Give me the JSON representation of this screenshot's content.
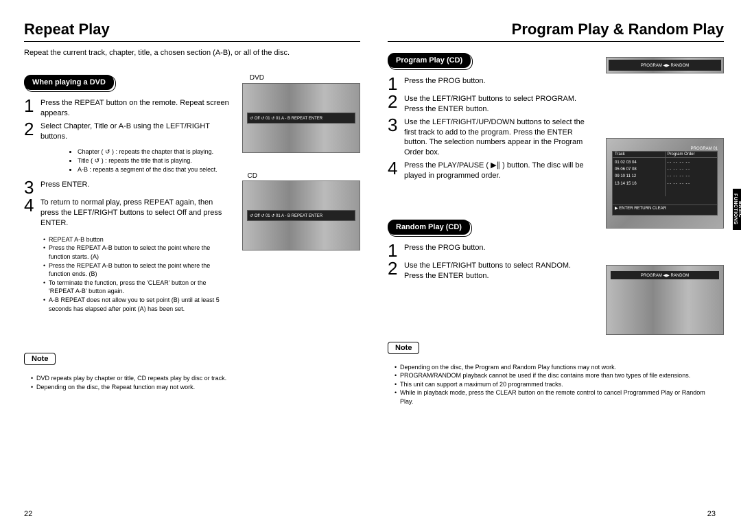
{
  "left": {
    "title": "Repeat Play",
    "intro": "Repeat the current track, chapter, title, a chosen section (A-B), or all of the disc.",
    "section1_label": "When playing a DVD",
    "dvd_label": "DVD",
    "cd_label": "CD",
    "step1": "Press the REPEAT button on the remote. Repeat screen appears.",
    "step2": "Select Chapter, Title or A-B using the LEFT/RIGHT buttons.",
    "sub_chapter": "Chapter ( ↺ ) : repeats the chapter that is playing.",
    "sub_title": "Title ( ↺ ) : repeats the title that is playing.",
    "sub_ab": "A-B : repeats a segment of the disc that you select.",
    "step3": "Press ENTER.",
    "step4": "To return to normal play, press REPEAT again, then press the LEFT/RIGHT buttons to select Off and press ENTER.",
    "ab_notes": [
      "REPEAT A-B button",
      "Press the REPEAT A-B button to select the point where the function starts. (A)",
      "Press the REPEAT A-B button to select the point where the function ends. (B)",
      "To terminate the function, press the 'CLEAR' button or the 'REPEAT A-B' button again.",
      "A-B REPEAT does not allow you to set point (B) until at least 5 seconds has elapsed after point (A) has been set."
    ],
    "note_label": "Note",
    "notes": [
      "DVD repeats play by chapter or title, CD repeats play by disc or track.",
      "Depending on the disc, the Repeat function may not work."
    ],
    "osd_dvd": "↺  Off  ↺ 01  ↺ 01   A - B   REPEAT ENTER",
    "osd_cd": "↺  Off  ↺ 01  ↺ 01   A - B   REPEAT ENTER",
    "pageno": "22"
  },
  "right": {
    "title": "Program Play & Random Play",
    "section1_label": "Program Play (CD)",
    "p_step1": "Press the PROG button.",
    "p_step2": "Use the LEFT/RIGHT buttons to select PROGRAM. Press the ENTER button.",
    "p_step3": "Use the LEFT/RIGHT/UP/DOWN buttons to select the first track to add to the program. Press the ENTER button. The selection numbers appear in the Program Order box.",
    "p_step4": "Press the PLAY/PAUSE ( ▶∥ ) button. The disc will be played in programmed order.",
    "prog_header": "PROGRAM  ◀▶  RANDOM",
    "prog_title": "PROGRAM 01",
    "prog_col1": "Track",
    "prog_col2": "Program  Order",
    "prog_nums": "01 02 03 04\n05 06 07 08\n09 10 11 12\n13 14 15 16",
    "prog_dashes": "- -  - -  - -  - -\n- -  - -  - -  - -\n- -  - -  - -  - -\n- -  - -  - -  - -",
    "prog_footer": "▶   ENTER   RETURN   CLEAR",
    "section2_label": "Random Play (CD)",
    "r_step1": "Press the PROG button.",
    "r_step2": "Use the LEFT/RIGHT buttons to select RANDOM. Press the ENTER button.",
    "rand_header": "PROGRAM  ◀▶  RANDOM",
    "note_label": "Note",
    "notes": [
      "Depending on the disc, the Program and Random Play functions may not work.",
      "PROGRAM/RANDOM playback cannot be used if the disc contains more than two types of file extensions.",
      "This unit can support a maximum of 20 programmed tracks.",
      "While in playback mode, press the CLEAR button on the remote control to cancel Programmed Play or Random Play."
    ],
    "side_tab": "BASIC FUNCTIONS",
    "pageno": "23"
  }
}
